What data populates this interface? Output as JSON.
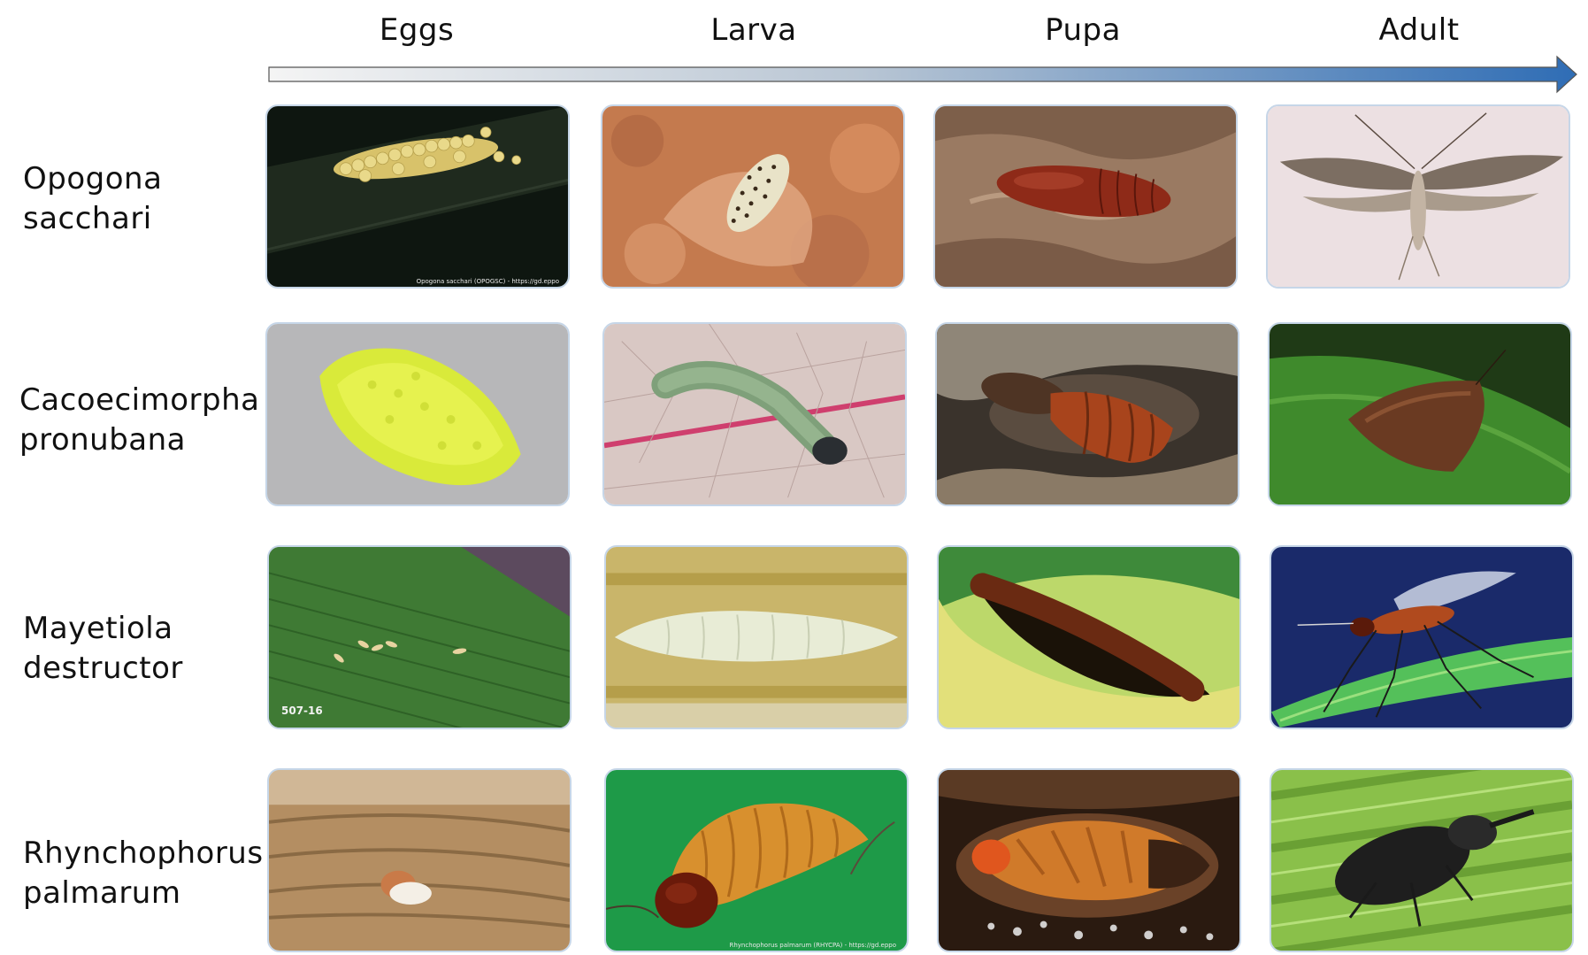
{
  "stages": [
    "Eggs",
    "Larva",
    "Pupa",
    "Adult"
  ],
  "species": [
    {
      "line1": "Opogona",
      "line2": "sacchari"
    },
    {
      "line1": "Cacoecimorpha",
      "line2": "pronubana"
    },
    {
      "line1": "Mayetiola",
      "line2": "destructor"
    },
    {
      "line1": "Rhynchophorus",
      "line2": "palmarum"
    }
  ],
  "captions": {
    "opogona_eggs": "Opogona sacchari (OPOGSC) - https://gd.eppo",
    "mayetiola_eggs": "507-16",
    "rhynchophorus_larva": "Rhynchophorus palmarum (RHYCPA) - https://gd.eppo"
  },
  "colors": {
    "arrow_start": "#f4f4f4",
    "arrow_end": "#2f6db5",
    "tile_border": "#c6d6e8"
  }
}
